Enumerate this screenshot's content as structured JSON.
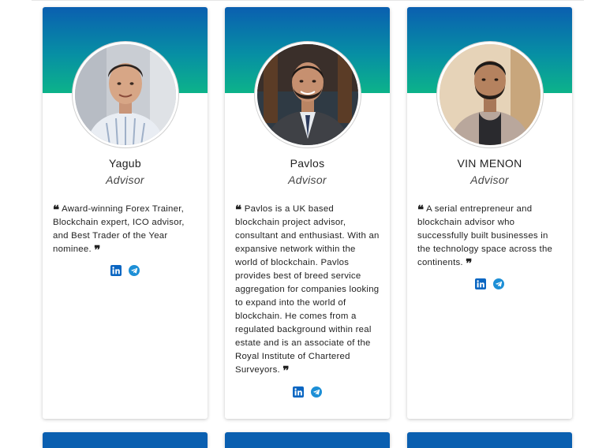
{
  "team": [
    {
      "name": "Yagub",
      "role": "Advisor",
      "bio": "Award-winning Forex Trainer, Blockchain expert, ICO advisor, and Best Trader of the Year nominee.",
      "links": [
        "linkedin-icon",
        "telegram-icon"
      ]
    },
    {
      "name": "Pavlos",
      "role": "Advisor",
      "bio": "Pavlos is a UK based blockchain project advisor, consultant and enthusiast. With an expansive network within the world of blockchain. Pavlos provides best of breed service aggregation for companies looking to expand into the world of blockchain. He comes from a regulated background within real estate and is an associate of the Royal Institute of Chartered Surveyors.",
      "links": [
        "linkedin-icon",
        "telegram-icon"
      ]
    },
    {
      "name": "VIN MENON",
      "role": "Advisor",
      "bio": "A serial entrepreneur and blockchain advisor who successfully built businesses in the technology space across the continents.",
      "links": [
        "linkedin-icon",
        "telegram-icon"
      ]
    }
  ],
  "colors": {
    "banner_top": "#0a5fb0",
    "banner_bottom": "#0cb38a",
    "linkedin": "#0a66c2",
    "telegram": "#1d8fd6"
  },
  "quote_open": "❝",
  "quote_close": "❞"
}
